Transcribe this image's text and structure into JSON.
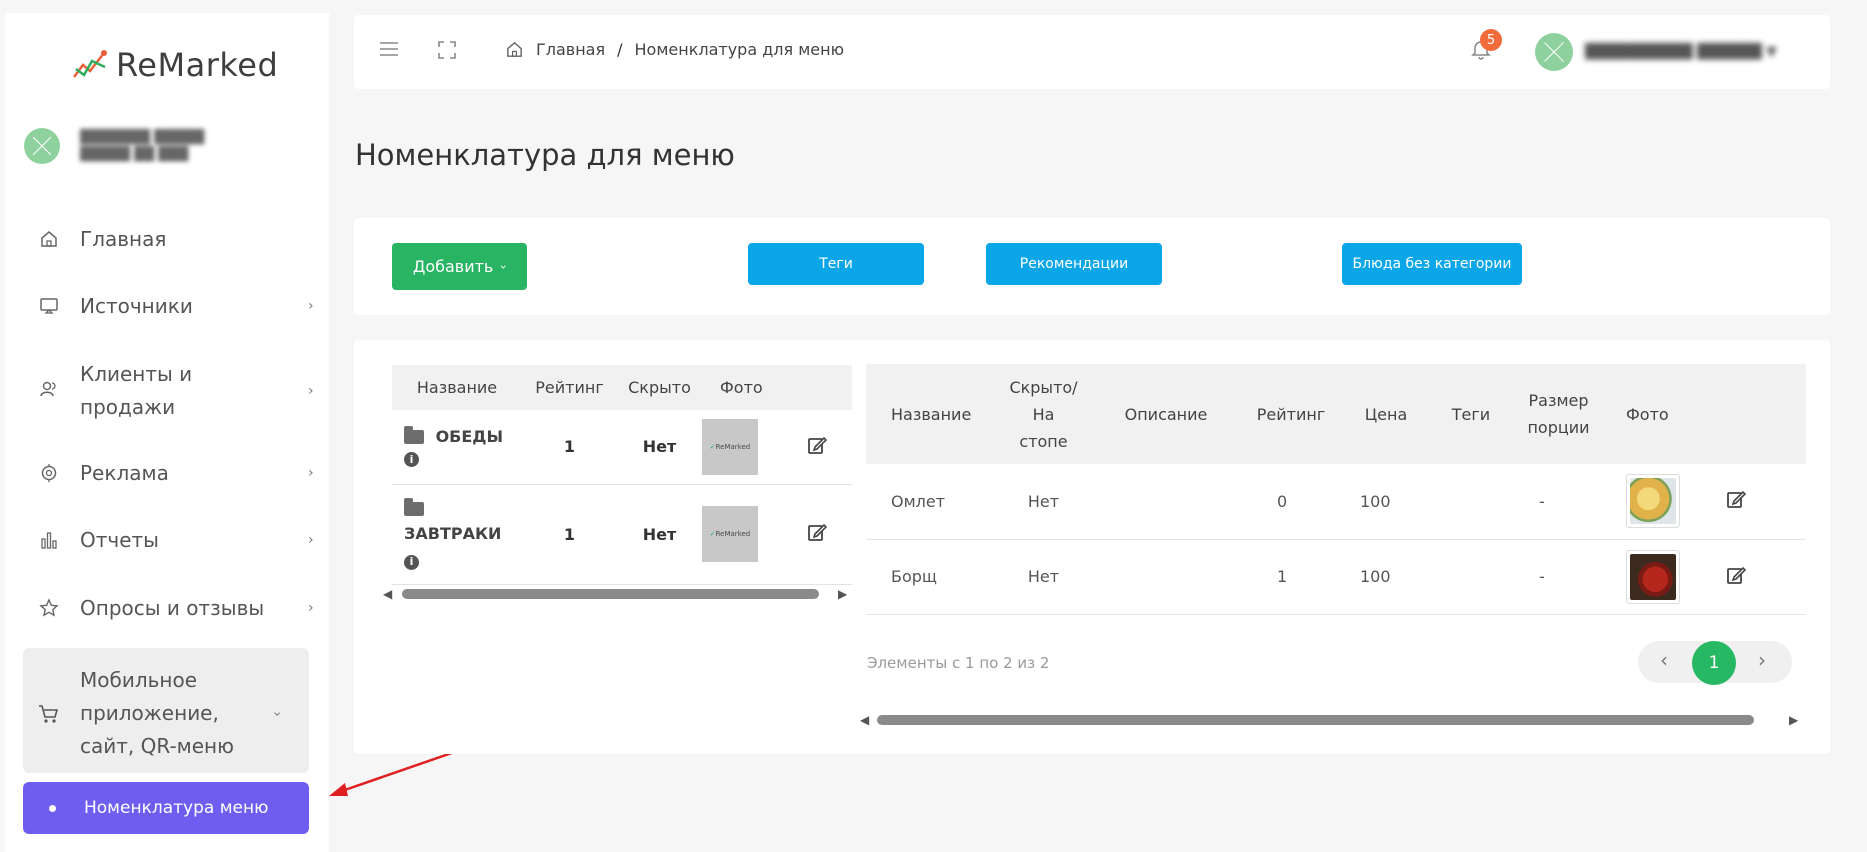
{
  "brand": {
    "name": "ReMarked",
    "line_colors": [
      "#e8613a",
      "#2fae5f"
    ]
  },
  "sidebar": {
    "items": [
      {
        "label": "Главная",
        "icon": "home-icon"
      },
      {
        "label": "Источники",
        "icon": "monitor-icon"
      },
      {
        "label": "Клиенты и продажи",
        "icon": "users-icon"
      },
      {
        "label": "Реклама",
        "icon": "target-icon"
      },
      {
        "label": "Отчеты",
        "icon": "bar-chart-icon"
      },
      {
        "label": "Опросы и отзывы",
        "icon": "star-icon"
      },
      {
        "label": "Мобильное приложение, сайт, QR-меню",
        "icon": "cart-icon"
      }
    ],
    "active_subitem": "Номенклатура меню"
  },
  "header": {
    "breadcrumb_home": "Главная",
    "breadcrumb_sep": "/",
    "breadcrumb_current": "Номенклатура для меню",
    "notifications_count": "5"
  },
  "page": {
    "title": "Номенклатура для меню"
  },
  "actions": {
    "add": "Добавить",
    "tags": "Теги",
    "recommendations": "Рекомендации",
    "uncategorized": "Блюда без категории"
  },
  "categories_table": {
    "columns": [
      "Название",
      "Рейтинг",
      "Скрыто",
      "Фото"
    ],
    "rows": [
      {
        "name": "ОБЕДЫ",
        "rating": "1",
        "hidden": "Нет",
        "thumb_text": "ReMarked"
      },
      {
        "name": "ЗАВТРАКИ",
        "rating": "1",
        "hidden": "Нет",
        "thumb_text": "ReMarked"
      }
    ]
  },
  "dishes_table": {
    "columns": [
      "Название",
      "Скрыто/ На стопе",
      "Описание",
      "Рейтинг",
      "Цена",
      "Теги",
      "Размер порции",
      "Фото"
    ],
    "rows": [
      {
        "name": "Омлет",
        "hidden": "Нет",
        "description": "",
        "rating": "0",
        "price": "100",
        "tags": "",
        "portion": "-"
      },
      {
        "name": "Борщ",
        "hidden": "Нет",
        "description": "",
        "rating": "1",
        "price": "100",
        "tags": "",
        "portion": "-"
      }
    ]
  },
  "pagination": {
    "info": "Элементы с 1 по 2 из 2",
    "current": "1"
  },
  "colors": {
    "accent_purple": "#6e5ef0",
    "green": "#28b463",
    "blue": "#0aa6e8",
    "badge": "#f26b3a"
  }
}
